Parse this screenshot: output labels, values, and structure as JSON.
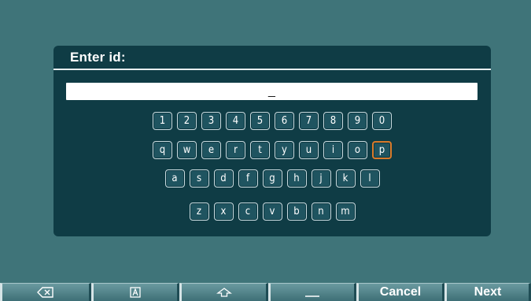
{
  "dialog": {
    "title": "Enter id:",
    "input_value": "_"
  },
  "keyboard": {
    "rows": [
      [
        "1",
        "2",
        "3",
        "4",
        "5",
        "6",
        "7",
        "8",
        "9",
        "0"
      ],
      [
        "q",
        "w",
        "e",
        "r",
        "t",
        "y",
        "u",
        "i",
        "o",
        "p"
      ],
      [
        "a",
        "s",
        "d",
        "f",
        "g",
        "h",
        "j",
        "k",
        "l"
      ],
      [
        "z",
        "x",
        "c",
        "v",
        "b",
        "n",
        "m"
      ]
    ],
    "selected_key": "p"
  },
  "bottom_bar": {
    "buttons": [
      {
        "id": "backspace",
        "label": "",
        "icon": "backspace-icon"
      },
      {
        "id": "caps",
        "label": "",
        "icon": "caps-lock-icon"
      },
      {
        "id": "shift",
        "label": "",
        "icon": "shift-arrow-icon"
      },
      {
        "id": "space",
        "label": "",
        "icon": "space-bar-icon"
      },
      {
        "id": "cancel",
        "label": "Cancel",
        "icon": ""
      },
      {
        "id": "next",
        "label": "Next",
        "icon": ""
      }
    ]
  },
  "colors": {
    "background": "#3f7479",
    "dialog": "#0f3c45",
    "key_fill": "#1f5460",
    "selected_outline": "#d97a2a"
  }
}
